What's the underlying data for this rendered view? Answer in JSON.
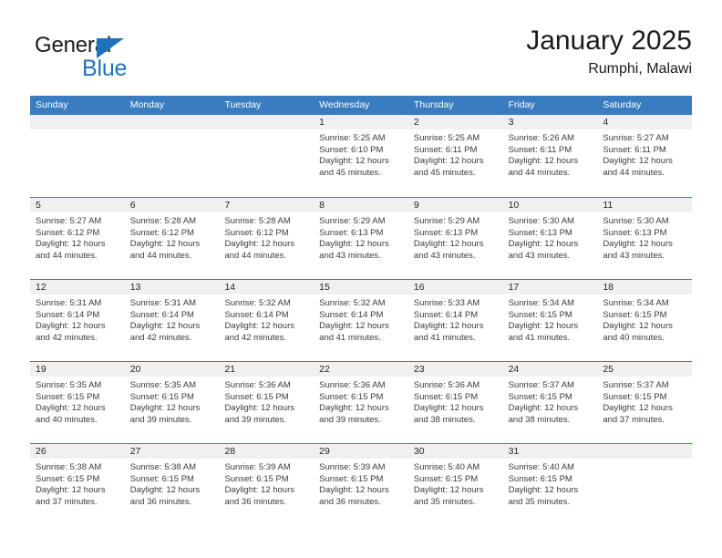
{
  "brand": {
    "name_part1": "General",
    "name_part2": "Blue",
    "triangle_icon": "triangle-icon",
    "color_dark": "#1b1b1b",
    "color_blue": "#1e72bd"
  },
  "header": {
    "title": "January 2025",
    "subtitle": "Rumphi, Malawi"
  },
  "theme": {
    "header_bg": "#3a7cc0",
    "day_band_bg": "#f0f0f0",
    "text": "#3b3b3b"
  },
  "weekdays": [
    "Sunday",
    "Monday",
    "Tuesday",
    "Wednesday",
    "Thursday",
    "Friday",
    "Saturday"
  ],
  "weeks": [
    [
      {
        "day": "",
        "lines": []
      },
      {
        "day": "",
        "lines": []
      },
      {
        "day": "",
        "lines": []
      },
      {
        "day": "1",
        "lines": [
          "Sunrise: 5:25 AM",
          "Sunset: 6:10 PM",
          "Daylight: 12 hours",
          "and 45 minutes."
        ]
      },
      {
        "day": "2",
        "lines": [
          "Sunrise: 5:25 AM",
          "Sunset: 6:11 PM",
          "Daylight: 12 hours",
          "and 45 minutes."
        ]
      },
      {
        "day": "3",
        "lines": [
          "Sunrise: 5:26 AM",
          "Sunset: 6:11 PM",
          "Daylight: 12 hours",
          "and 44 minutes."
        ]
      },
      {
        "day": "4",
        "lines": [
          "Sunrise: 5:27 AM",
          "Sunset: 6:11 PM",
          "Daylight: 12 hours",
          "and 44 minutes."
        ]
      }
    ],
    [
      {
        "day": "5",
        "lines": [
          "Sunrise: 5:27 AM",
          "Sunset: 6:12 PM",
          "Daylight: 12 hours",
          "and 44 minutes."
        ]
      },
      {
        "day": "6",
        "lines": [
          "Sunrise: 5:28 AM",
          "Sunset: 6:12 PM",
          "Daylight: 12 hours",
          "and 44 minutes."
        ]
      },
      {
        "day": "7",
        "lines": [
          "Sunrise: 5:28 AM",
          "Sunset: 6:12 PM",
          "Daylight: 12 hours",
          "and 44 minutes."
        ]
      },
      {
        "day": "8",
        "lines": [
          "Sunrise: 5:29 AM",
          "Sunset: 6:13 PM",
          "Daylight: 12 hours",
          "and 43 minutes."
        ]
      },
      {
        "day": "9",
        "lines": [
          "Sunrise: 5:29 AM",
          "Sunset: 6:13 PM",
          "Daylight: 12 hours",
          "and 43 minutes."
        ]
      },
      {
        "day": "10",
        "lines": [
          "Sunrise: 5:30 AM",
          "Sunset: 6:13 PM",
          "Daylight: 12 hours",
          "and 43 minutes."
        ]
      },
      {
        "day": "11",
        "lines": [
          "Sunrise: 5:30 AM",
          "Sunset: 6:13 PM",
          "Daylight: 12 hours",
          "and 43 minutes."
        ]
      }
    ],
    [
      {
        "day": "12",
        "lines": [
          "Sunrise: 5:31 AM",
          "Sunset: 6:14 PM",
          "Daylight: 12 hours",
          "and 42 minutes."
        ]
      },
      {
        "day": "13",
        "lines": [
          "Sunrise: 5:31 AM",
          "Sunset: 6:14 PM",
          "Daylight: 12 hours",
          "and 42 minutes."
        ]
      },
      {
        "day": "14",
        "lines": [
          "Sunrise: 5:32 AM",
          "Sunset: 6:14 PM",
          "Daylight: 12 hours",
          "and 42 minutes."
        ]
      },
      {
        "day": "15",
        "lines": [
          "Sunrise: 5:32 AM",
          "Sunset: 6:14 PM",
          "Daylight: 12 hours",
          "and 41 minutes."
        ]
      },
      {
        "day": "16",
        "lines": [
          "Sunrise: 5:33 AM",
          "Sunset: 6:14 PM",
          "Daylight: 12 hours",
          "and 41 minutes."
        ]
      },
      {
        "day": "17",
        "lines": [
          "Sunrise: 5:34 AM",
          "Sunset: 6:15 PM",
          "Daylight: 12 hours",
          "and 41 minutes."
        ]
      },
      {
        "day": "18",
        "lines": [
          "Sunrise: 5:34 AM",
          "Sunset: 6:15 PM",
          "Daylight: 12 hours",
          "and 40 minutes."
        ]
      }
    ],
    [
      {
        "day": "19",
        "lines": [
          "Sunrise: 5:35 AM",
          "Sunset: 6:15 PM",
          "Daylight: 12 hours",
          "and 40 minutes."
        ]
      },
      {
        "day": "20",
        "lines": [
          "Sunrise: 5:35 AM",
          "Sunset: 6:15 PM",
          "Daylight: 12 hours",
          "and 39 minutes."
        ]
      },
      {
        "day": "21",
        "lines": [
          "Sunrise: 5:36 AM",
          "Sunset: 6:15 PM",
          "Daylight: 12 hours",
          "and 39 minutes."
        ]
      },
      {
        "day": "22",
        "lines": [
          "Sunrise: 5:36 AM",
          "Sunset: 6:15 PM",
          "Daylight: 12 hours",
          "and 39 minutes."
        ]
      },
      {
        "day": "23",
        "lines": [
          "Sunrise: 5:36 AM",
          "Sunset: 6:15 PM",
          "Daylight: 12 hours",
          "and 38 minutes."
        ]
      },
      {
        "day": "24",
        "lines": [
          "Sunrise: 5:37 AM",
          "Sunset: 6:15 PM",
          "Daylight: 12 hours",
          "and 38 minutes."
        ]
      },
      {
        "day": "25",
        "lines": [
          "Sunrise: 5:37 AM",
          "Sunset: 6:15 PM",
          "Daylight: 12 hours",
          "and 37 minutes."
        ]
      }
    ],
    [
      {
        "day": "26",
        "lines": [
          "Sunrise: 5:38 AM",
          "Sunset: 6:15 PM",
          "Daylight: 12 hours",
          "and 37 minutes."
        ]
      },
      {
        "day": "27",
        "lines": [
          "Sunrise: 5:38 AM",
          "Sunset: 6:15 PM",
          "Daylight: 12 hours",
          "and 36 minutes."
        ]
      },
      {
        "day": "28",
        "lines": [
          "Sunrise: 5:39 AM",
          "Sunset: 6:15 PM",
          "Daylight: 12 hours",
          "and 36 minutes."
        ]
      },
      {
        "day": "29",
        "lines": [
          "Sunrise: 5:39 AM",
          "Sunset: 6:15 PM",
          "Daylight: 12 hours",
          "and 36 minutes."
        ]
      },
      {
        "day": "30",
        "lines": [
          "Sunrise: 5:40 AM",
          "Sunset: 6:15 PM",
          "Daylight: 12 hours",
          "and 35 minutes."
        ]
      },
      {
        "day": "31",
        "lines": [
          "Sunrise: 5:40 AM",
          "Sunset: 6:15 PM",
          "Daylight: 12 hours",
          "and 35 minutes."
        ]
      },
      {
        "day": "",
        "lines": []
      }
    ]
  ]
}
